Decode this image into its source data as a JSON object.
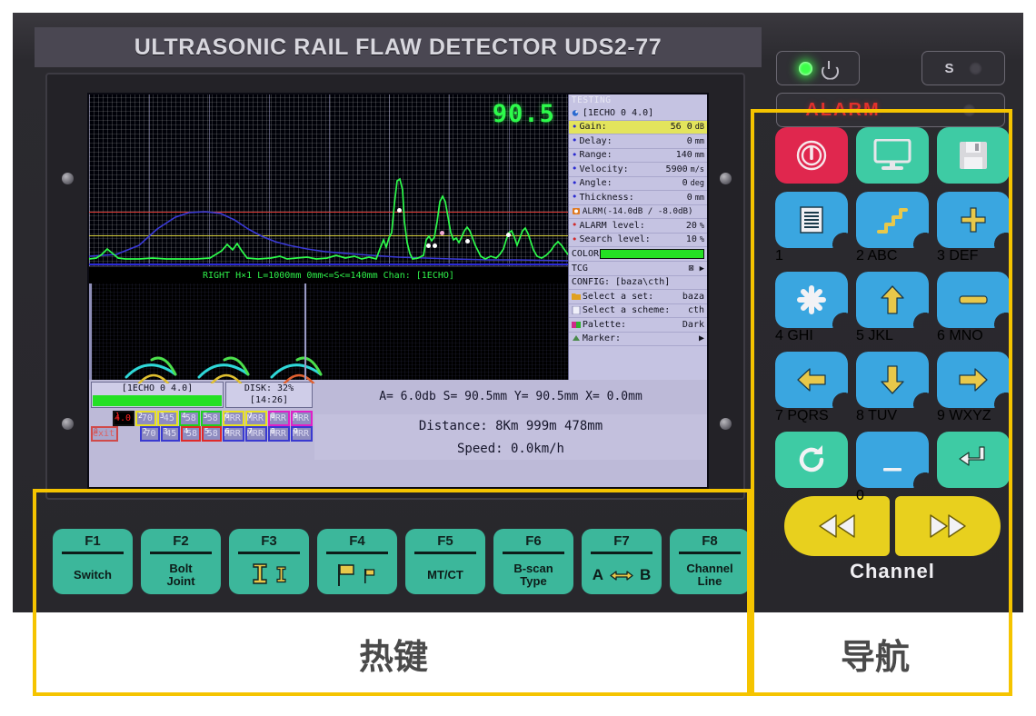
{
  "device": {
    "title": "ULTRASONIC RAIL FLAW DETECTOR UDS2-77"
  },
  "indicators": {
    "power_icon": "power-icon",
    "s_label": "S",
    "alarm_label": "ALARM"
  },
  "ascan": {
    "reading": "90.5",
    "status_strip": "RIGHT H×1  L=1000mm 0mm<=S<=140mm Chan: [1ECHO]",
    "threshold_red_color": "#e03a34",
    "threshold_yellow_color": "#d6cf3c",
    "trace_color": "#2dfb4b",
    "envelope_color": "#3a3ad0"
  },
  "params": {
    "title": "TESTING",
    "channel_header": "[1ECHO 0 4.0]",
    "rows": [
      {
        "label": "Gain:",
        "value": "56 0",
        "unit": "dB",
        "selected": true
      },
      {
        "label": "Delay:",
        "value": "0",
        "unit": "mm",
        "selected": false
      },
      {
        "label": "Range:",
        "value": "140",
        "unit": "mm",
        "selected": false
      },
      {
        "label": "Velocity:",
        "value": "5900",
        "unit": "m/s",
        "selected": false
      },
      {
        "label": "Angle:",
        "value": "0",
        "unit": "deg",
        "selected": false
      },
      {
        "label": "Thickness:",
        "value": "0",
        "unit": "mm",
        "selected": false
      }
    ],
    "alarm_header": "ALRM(-14.0dB / -8.0dB)",
    "alarm_rows": [
      {
        "label": "ALARM level:",
        "value": "20",
        "unit": "%"
      },
      {
        "label": "Search level:",
        "value": "10",
        "unit": "%"
      }
    ],
    "color_label": "COLOR",
    "color_value": "#24e024",
    "tcg_label": "TCG",
    "config_label": "CONFIG: [baza\\cth]",
    "config_rows": [
      {
        "label": "Select a set:",
        "value": "baza"
      },
      {
        "label": "Select a scheme:",
        "value": "cth"
      },
      {
        "label": "Palette:",
        "value": "Dark"
      },
      {
        "label": "Marker:",
        "value": ""
      }
    ]
  },
  "readout": {
    "echo_label": "[1ECHO 0 4.0]",
    "disk_label": "DISK: 32%",
    "time_label": "[14:26]",
    "measure_line": "A= 6.0db S= 90.5mm Y= 90.5mm X=  0.0mm",
    "distance_line": "Distance:       8Km 999m 478mm",
    "speed_line": "Speed: 0.0km/h"
  },
  "channels": {
    "row1": [
      {
        "index": "",
        "text": "",
        "style": "blank"
      },
      {
        "index": "1",
        "text": "4.0",
        "style": "active"
      },
      {
        "index": "2",
        "text": "70",
        "style": "yellow"
      },
      {
        "index": "3",
        "text": "45",
        "style": "yellow"
      },
      {
        "index": "4",
        "text": "58",
        "style": "green"
      },
      {
        "index": "5",
        "text": "58",
        "style": "green"
      },
      {
        "index": "6",
        "text": "MRR",
        "style": "yellow"
      },
      {
        "index": "7",
        "text": "MRR",
        "style": "yellow"
      },
      {
        "index": "8",
        "text": "MRR",
        "style": "magenta"
      },
      {
        "index": "9",
        "text": "MRR",
        "style": "magenta"
      }
    ],
    "row2": [
      {
        "index": "0",
        "text": "exit",
        "style": "exit"
      },
      {
        "index": "",
        "text": "",
        "style": "blank"
      },
      {
        "index": "2",
        "text": "70",
        "style": "blue"
      },
      {
        "index": "3",
        "text": "45",
        "style": "blue"
      },
      {
        "index": "4",
        "text": "58",
        "style": "red"
      },
      {
        "index": "5",
        "text": "58",
        "style": "red"
      },
      {
        "index": "6",
        "text": "MRR",
        "style": "blue"
      },
      {
        "index": "7",
        "text": "MRR",
        "style": "blue"
      },
      {
        "index": "8",
        "text": "MRR",
        "style": "blue"
      },
      {
        "index": "9",
        "text": "MRR",
        "style": "blue"
      }
    ]
  },
  "fkeys": [
    {
      "key": "F1",
      "label": "Switch",
      "icon": ""
    },
    {
      "key": "F2",
      "label": "Bolt\nJoint",
      "icon": ""
    },
    {
      "key": "F3",
      "label": "",
      "icon": "rail-profile-icon"
    },
    {
      "key": "F4",
      "label": "",
      "icon": "flag-icon"
    },
    {
      "key": "F5",
      "label": "MT/CT",
      "icon": ""
    },
    {
      "key": "F6",
      "label": "B-scan\nType",
      "icon": ""
    },
    {
      "key": "F7",
      "label": "",
      "icon": "a-b-swap-icon"
    },
    {
      "key": "F8",
      "label": "Channel\nLine",
      "icon": ""
    }
  ],
  "keypad": {
    "rows": [
      [
        {
          "name": "power-button",
          "color": "red",
          "glyph": "power-icon",
          "num": "",
          "letters": ""
        },
        {
          "name": "display-button",
          "color": "green",
          "glyph": "monitor-icon",
          "num": "",
          "letters": ""
        },
        {
          "name": "save-button",
          "color": "green",
          "glyph": "floppy-icon",
          "num": "",
          "letters": ""
        }
      ],
      [
        {
          "name": "key-1",
          "color": "blue",
          "glyph": "document-icon",
          "num": "1",
          "letters": ""
        },
        {
          "name": "key-2",
          "color": "blue",
          "glyph": "steps-icon",
          "num": "2",
          "letters": "ABC"
        },
        {
          "name": "key-3",
          "color": "blue",
          "glyph": "plus-icon",
          "num": "3",
          "letters": "DEF"
        }
      ],
      [
        {
          "name": "key-4",
          "color": "blue",
          "glyph": "asterisk-icon",
          "num": "4",
          "letters": "GHI"
        },
        {
          "name": "key-5",
          "color": "blue",
          "glyph": "arrow-up-icon",
          "num": "5",
          "letters": "JKL"
        },
        {
          "name": "key-6",
          "color": "blue",
          "glyph": "minus-icon",
          "num": "6",
          "letters": "MNO"
        }
      ],
      [
        {
          "name": "key-7",
          "color": "blue",
          "glyph": "arrow-left-icon",
          "num": "7",
          "letters": "PQRS"
        },
        {
          "name": "key-8",
          "color": "blue",
          "glyph": "arrow-down-icon",
          "num": "8",
          "letters": "TUV"
        },
        {
          "name": "key-9",
          "color": "blue",
          "glyph": "arrow-right-icon",
          "num": "9",
          "letters": "WXYZ"
        }
      ],
      [
        {
          "name": "refresh-button",
          "color": "green",
          "glyph": "refresh-icon",
          "num": "",
          "letters": ""
        },
        {
          "name": "key-0",
          "color": "blue",
          "glyph": "underscore-icon",
          "num": "0",
          "letters": ""
        },
        {
          "name": "enter-button",
          "color": "green",
          "glyph": "enter-icon",
          "num": "",
          "letters": ""
        }
      ]
    ],
    "channel_prev": "prev-icon",
    "channel_next": "next-icon",
    "channel_label": "Channel"
  },
  "annotations": {
    "hotkeys_cn": "热键",
    "nav_cn": "导航",
    "box_color": "#f5c400"
  }
}
